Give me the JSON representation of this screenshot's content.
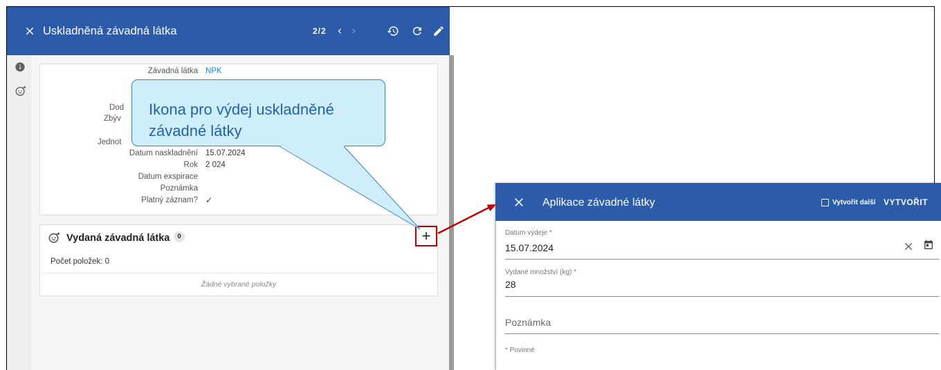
{
  "left_panel": {
    "header": {
      "close_icon": "close-icon",
      "title": "Uskladněná závadná látka",
      "pager": "2/2",
      "prev_icon": "chevron-left-icon",
      "next_icon": "chevron-right-icon",
      "next_disabled": true,
      "action_icons": [
        "history-icon",
        "refresh-icon",
        "edit-icon"
      ]
    },
    "sidebar": {
      "icons": [
        "info-icon",
        "hazardous-substance-icon"
      ]
    },
    "detail_card": {
      "rows": [
        {
          "label": "Závadná látka",
          "value": "NPK"
        },
        {
          "label": "Dod"
        },
        {
          "label": "Zbýv"
        },
        {
          "label": "Jednot"
        },
        {
          "label": "Datum naskladnění",
          "value": "15.07.2024"
        },
        {
          "label": "Rok",
          "value": "2 024"
        },
        {
          "label": "Datum exspirace"
        },
        {
          "label": "Poznámka"
        },
        {
          "label": "Platný záznam?",
          "value": "✓"
        }
      ]
    },
    "issued_card": {
      "icon": "hazardous-substance-icon",
      "title": "Vydaná závadná látka",
      "count_badge": "0",
      "add_button_label": "+",
      "item_count": "Počet položek: 0",
      "empty_text": "Žádné vybrané položky"
    }
  },
  "callout": {
    "lines": [
      "Ikona pro výdej uskladněné",
      "závadné látky"
    ]
  },
  "dialog": {
    "header": {
      "close_icon": "close-icon",
      "title": "Aplikace závadné látky",
      "create_another_checked": false,
      "create_another_label": "Vytvořit další",
      "create_button_label": "VYTVOŘIT"
    },
    "fields": [
      {
        "label": "Datum výdeje *",
        "value": "15.07.2024",
        "icons": [
          "clear-icon",
          "calendar-icon"
        ]
      },
      {
        "label": "Vydané množství (kg) *",
        "value": "28"
      },
      {
        "placeholder": "Poznámka",
        "value": ""
      }
    ],
    "required_note": "* Povinné"
  },
  "colors": {
    "header_blue": "#2c5ba9",
    "link_blue": "#1e88e5",
    "callout_fill": "#cdeefa",
    "callout_border": "#3f7fc0",
    "callout_text": "#2462ad",
    "highlight_red": "#c00000"
  }
}
